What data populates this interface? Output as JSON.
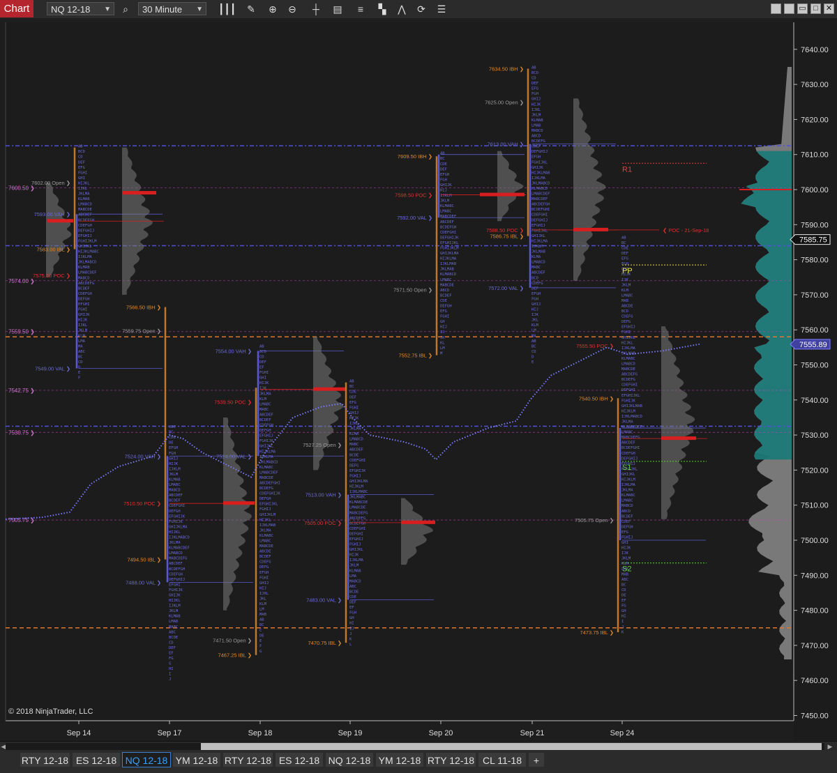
{
  "toolbar": {
    "chart_label": "Chart",
    "instrument": "NQ 12-18",
    "interval": "30 Minute",
    "icons": [
      "search-icon",
      "bar-type-icon",
      "draw-pencil-icon",
      "zoom-in-icon",
      "zoom-out-icon",
      "crosshair-icon",
      "data-box-icon",
      "indicators-icon",
      "strategies-icon",
      "chart-trader-icon",
      "reload-icon",
      "properties-icon"
    ],
    "window_buttons": [
      "minimize-icon",
      "restore-icon",
      "maximize-icon",
      "close-icon"
    ]
  },
  "chart": {
    "copyright": "© 2018 NinjaTrader, LLC",
    "price_scale": [
      "7640.00",
      "7630.00",
      "7620.00",
      "7610.00",
      "7600.00",
      "7590.00",
      "7580.00",
      "7570.00",
      "7560.00",
      "7550.00",
      "7540.00",
      "7530.00",
      "7520.00",
      "7510.00",
      "7500.00",
      "7490.00",
      "7480.00",
      "7470.00",
      "7460.00",
      "7450.00"
    ],
    "last_price": "7585.75",
    "vwap_price": "7555.89",
    "dates": [
      "Sep 14",
      "Sep 17",
      "Sep 18",
      "Sep 19",
      "Sep 20",
      "Sep 21",
      "Sep 24"
    ],
    "left_levels": [
      "7600.50",
      "7574.00",
      "7559.50",
      "7542.75",
      "7530.75",
      "7505.75"
    ],
    "pivots": [
      "R1",
      "PP",
      "S1",
      "S2"
    ],
    "annotations": [
      {
        "t": "7602.00 Open",
        "p": 7602,
        "d": 0,
        "c": "#9a9a9a"
      },
      {
        "t": "7593.00 VAH",
        "p": 7593,
        "d": 0,
        "c": "#6a6ad8"
      },
      {
        "t": "7583.00 IBL",
        "p": 7583,
        "d": 0,
        "c": "#e08a2a"
      },
      {
        "t": "7575.50 POC",
        "p": 7575.5,
        "d": 0,
        "c": "#e03030"
      },
      {
        "t": "7549.00 VAL",
        "p": 7549,
        "d": 0,
        "c": "#6a6ad8"
      },
      {
        "t": "7566.50 IBH",
        "p": 7566.5,
        "d": 1,
        "c": "#e08a2a"
      },
      {
        "t": "7559.75 Open",
        "p": 7559.75,
        "d": 1,
        "c": "#9a9a9a"
      },
      {
        "t": "7524.00 VAH",
        "p": 7524,
        "d": 1,
        "c": "#6a6ad8"
      },
      {
        "t": "7510.50 POC",
        "p": 7510.5,
        "d": 1,
        "c": "#e03030"
      },
      {
        "t": "7494.50 IBL",
        "p": 7494.5,
        "d": 1,
        "c": "#e08a2a"
      },
      {
        "t": "7488.00 VAL",
        "p": 7488,
        "d": 1,
        "c": "#6a6ad8"
      },
      {
        "t": "7554.00 VAH",
        "p": 7554,
        "d": 2,
        "c": "#6a6ad8"
      },
      {
        "t": "7539.50 POC",
        "p": 7539.5,
        "d": 2,
        "c": "#e03030"
      },
      {
        "t": "7524.00 VAL",
        "p": 7524,
        "d": 2,
        "c": "#6a6ad8"
      },
      {
        "t": "7471.50 Open",
        "p": 7471.5,
        "d": 2,
        "c": "#9a9a9a"
      },
      {
        "t": "7467.25 IBL",
        "p": 7467.25,
        "d": 2,
        "c": "#e08a2a"
      },
      {
        "t": "7527.25 Open",
        "p": 7527.25,
        "d": 3,
        "c": "#9a9a9a"
      },
      {
        "t": "7513.00 VAH",
        "p": 7513,
        "d": 3,
        "c": "#6a6ad8"
      },
      {
        "t": "7505.00 POC",
        "p": 7505,
        "d": 3,
        "c": "#e03030"
      },
      {
        "t": "7483.00 VAL",
        "p": 7483,
        "d": 3,
        "c": "#6a6ad8"
      },
      {
        "t": "7470.75 IBL",
        "p": 7470.75,
        "d": 3,
        "c": "#e08a2a"
      },
      {
        "t": "7609.50 IBH",
        "p": 7609.5,
        "d": 4,
        "c": "#e08a2a"
      },
      {
        "t": "7598.50 POC",
        "p": 7598.5,
        "d": 4,
        "c": "#e03030"
      },
      {
        "t": "7592.00 VAL",
        "p": 7592,
        "d": 4,
        "c": "#6a6ad8"
      },
      {
        "t": "7571.50 Open",
        "p": 7571.5,
        "d": 4,
        "c": "#9a9a9a"
      },
      {
        "t": "7552.75 IBL",
        "p": 7552.75,
        "d": 4,
        "c": "#e08a2a"
      },
      {
        "t": "7634.50 IBH",
        "p": 7634.5,
        "d": 5,
        "c": "#e08a2a"
      },
      {
        "t": "7625.00 Open",
        "p": 7625,
        "d": 5,
        "c": "#9a9a9a"
      },
      {
        "t": "7613.00 VAH",
        "p": 7613,
        "d": 5,
        "c": "#6a6ad8"
      },
      {
        "t": "7588.50 POC",
        "p": 7588.5,
        "d": 5,
        "c": "#e03030"
      },
      {
        "t": "7586.75 IBL",
        "p": 7586.75,
        "d": 5,
        "c": "#e08a2a"
      },
      {
        "t": "7572.00 VAL",
        "p": 7572,
        "d": 5,
        "c": "#6a6ad8"
      },
      {
        "t": "7555.50 POC",
        "p": 7555.5,
        "d": 6,
        "c": "#e03030"
      },
      {
        "t": "7540.50 IBH",
        "p": 7540.5,
        "d": 6,
        "c": "#e08a2a"
      },
      {
        "t": "7505.75 Open",
        "p": 7505.75,
        "d": 6,
        "c": "#9a9a9a"
      },
      {
        "t": "7473.75 IBL",
        "p": 7473.75,
        "d": 6,
        "c": "#e08a2a"
      }
    ],
    "poc_note": "POC - 21-Sep-18"
  },
  "tabs": [
    {
      "label": "RTY 12-18"
    },
    {
      "label": "ES 12-18"
    },
    {
      "label": "NQ 12-18",
      "active": true
    },
    {
      "label": "YM 12-18"
    },
    {
      "label": "RTY 12-18"
    },
    {
      "label": "ES 12-18"
    },
    {
      "label": "NQ 12-18"
    },
    {
      "label": "YM 12-18"
    },
    {
      "label": "RTY 12-18"
    },
    {
      "label": "CL 11-18"
    },
    {
      "label": "+"
    }
  ],
  "colors": {
    "ib_line": "#c0772a",
    "poc": "#d81e1e",
    "vah_val": "#5a5ad0",
    "open": "#9a9a9a",
    "profile_gray": "#7a7a7a",
    "volume_teal": "#1e7a78",
    "level_pink": "#c040c0",
    "dash_blue": "#5050d8",
    "dash_orange": "#e07830",
    "pivot_r": "#e04040",
    "pivot_pp": "#e8e840",
    "pivot_s": "#60d040"
  }
}
